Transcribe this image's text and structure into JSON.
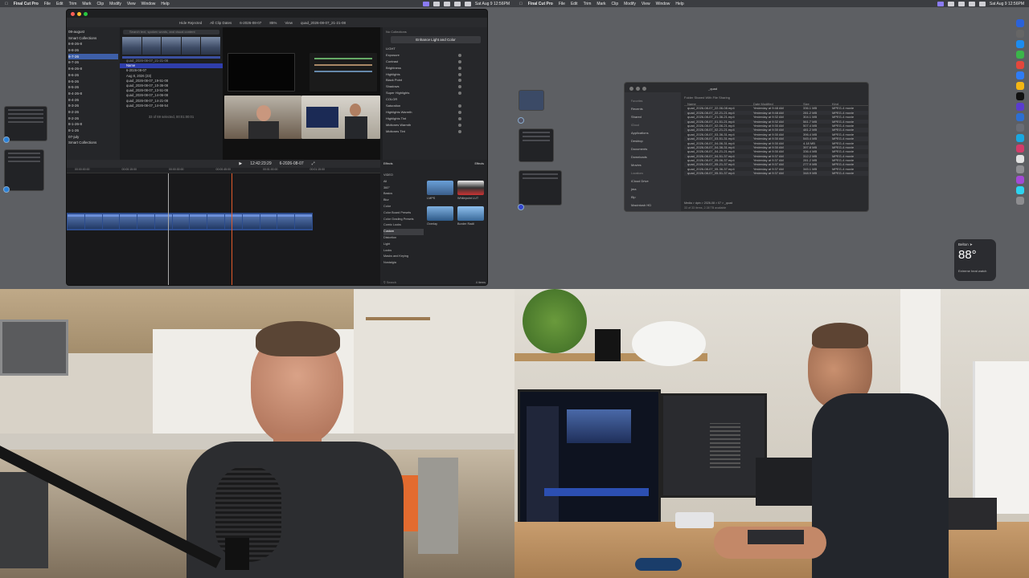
{
  "menubar": {
    "app": "Final Cut Pro",
    "items": [
      "File",
      "Edit",
      "Trim",
      "Mark",
      "Clip",
      "Modify",
      "View",
      "Window",
      "Help"
    ],
    "clock": "Sat Aug 9 12:56PM"
  },
  "fcp": {
    "toolbar": {
      "hide_rejected": "Hide Rejected",
      "clips_filter": "All Clip Dates",
      "project": "6-2026-08-07",
      "zoom": "85%",
      "view": "View",
      "inspector_clip": "quad_2026-08-07_21-21-08"
    },
    "library": {
      "items": [
        "08-august",
        "Smart Collections",
        "8-8-26-8",
        "8-8-26",
        "8-7-26",
        "8-7-26",
        "8-6-26-8",
        "8-6-26",
        "8-5-26",
        "8-5-26",
        "8-4-26-8",
        "8-4-26",
        "8-3-26",
        "8-2-26",
        "8-2-26",
        "8-1-26-8",
        "8-1-26",
        "07-july",
        "Smart Collections"
      ],
      "selected_index": 4
    },
    "browser": {
      "search_placeholder": "Search text, spoken words, and visual content",
      "filmstrip_label": "quad_2026-08-07_21-21-08",
      "name_header": "Name",
      "project_row": "6-2026-08-07",
      "date_row": "Aug 8, 2026",
      "date_count": "(33)",
      "clips": [
        "quad_2026-08-07_19-51-08",
        "quad_2026-08-07_10-36-08",
        "quad_2026-08-07_13-51-08",
        "quad_2026-08-07_14-06-08",
        "quad_2026-08-07_14-21-08",
        "quad_2026-08-07_14-66-54"
      ],
      "selection_status": "33 of 69 selected, 00:01:00:01"
    },
    "inspector": {
      "collections": "No Collections",
      "enhance_button": "Enhance Light and Color",
      "params": [
        "LIGHT",
        "Exposure",
        "Contrast",
        "Brightness",
        "Highlights",
        "Black Point",
        "Shadows",
        "Super Highlights",
        "COLOR",
        "Saturation",
        "Highlights Warmth",
        "Highlights Tint",
        "Midtones Warmth",
        "Midtones Tint"
      ]
    },
    "timeline": {
      "timecode": "12:42:23:29",
      "project_label": "6-2026-08-07",
      "ruler": [
        "00:00:00:00",
        "00:00:15:00",
        "00:00:30:00",
        "00:00:45:00",
        "00:01:00:00",
        "00:01:15:00"
      ]
    },
    "effects": {
      "title": "Effects",
      "header_right": "Effects",
      "categories": [
        "VIDEO",
        "All",
        "360°",
        "Basics",
        "Blur",
        "Color",
        "Color Board Presets",
        "Color Grading Presets",
        "Comic Looks",
        "Custom",
        "Distortion",
        "Light",
        "Looks",
        "Masks and Keying",
        "Nostalgia"
      ],
      "selected_index": 9,
      "thumbs": [
        "LMPS",
        "Whitepoint LUT",
        "Overlay",
        "Border Radii"
      ],
      "search_placeholder": "Search",
      "count": "4 items"
    }
  },
  "finder": {
    "title": "_quad",
    "sidebar": [
      "Favorites",
      "Recents",
      "Shared",
      "iCloud",
      "Applications",
      "Desktop",
      "Documents",
      "Downloads",
      "Movies",
      "Locations",
      "iCloud Drive",
      "jma",
      "f5p",
      "Macintosh HD",
      "Network"
    ],
    "info_bar": "Folder Shared With File Sharing",
    "columns": [
      "Name",
      "Date Modified",
      "Size",
      "Kind"
    ],
    "rows": [
      [
        "quad_2026-08-07_22-06-08.mp4",
        "Yesterday at 9:48 AM",
        "336.1 MB",
        "MPEG-4 movie"
      ],
      [
        "quad_2026-08-07_22-21-21.mp4",
        "Yesterday at 9:48 AM",
        "281.2 MB",
        "MPEG-4 movie"
      ],
      [
        "quad_2026-08-07_21-36-21.mp4",
        "Yesterday at 9:32 AM",
        "304.1 MB",
        "MPEG-4 movie"
      ],
      [
        "quad_2026-08-07_01-51-21.mp4",
        "Yesterday at 9:32 AM",
        "561.7 MB",
        "MPEG-4 movie"
      ],
      [
        "quad_2026-08-07_02-06-21.mp4",
        "Yesterday at 9:30 AM",
        "507.4 MB",
        "MPEG-4 movie"
      ],
      [
        "quad_2026-08-07_02-21-21.mp4",
        "Yesterday at 9:30 AM",
        "481.2 MB",
        "MPEG-4 movie"
      ],
      [
        "quad_2026-08-07_03-36-31.mp4",
        "Yesterday at 9:30 AM",
        "396.4 MB",
        "MPEG-4 movie"
      ],
      [
        "quad_2026-08-07_03-51-31.mp4",
        "Yesterday at 9:30 AM",
        "545.4 MB",
        "MPEG-4 movie"
      ],
      [
        "quad_2026-08-07_04-06-31.mp4",
        "Yesterday at 9:30 AM",
        "4.18 MB",
        "MPEG-4 movie"
      ],
      [
        "quad_2026-08-07_04-36-31.mp4",
        "Yesterday at 9:30 AM",
        "397.8 MB",
        "MPEG-4 movie"
      ],
      [
        "quad_2026-08-07_04-21-21.mp4",
        "Yesterday at 9:30 AM",
        "336.4 MB",
        "MPEG-4 movie"
      ],
      [
        "quad_2026-08-07_04-51-37.mp4",
        "Yesterday at 9:37 AM",
        "312.2 MB",
        "MPEG-4 movie"
      ],
      [
        "quad_2026-08-07_05-06-37.mp4",
        "Yesterday at 9:37 AM",
        "281.2 MB",
        "MPEG-4 movie"
      ],
      [
        "quad_2026-08-07_05-21-37.mp4",
        "Yesterday at 9:37 AM",
        "277.9 MB",
        "MPEG-4 movie"
      ],
      [
        "quad_2026-08-07_05-36-37.mp4",
        "Yesterday at 9:37 AM",
        "345.1 MB",
        "MPEG-4 movie"
      ],
      [
        "quad_2026-08-07_05-51-37.mp4",
        "Yesterday at 9:37 AM",
        "348.9 MB",
        "MPEG-4 movie"
      ]
    ],
    "path_bar": "Media > dpin > 2026-08 > 07 > _quad",
    "status": "33 of 33 items, 2.38 TB available"
  },
  "weather": {
    "location": "Belton",
    "temperature": "88°",
    "condition": "Extreme heat watch"
  },
  "colors": {
    "accent": "#8b7cf6",
    "selection": "#3e5fa8",
    "playhead": "#e05a2a"
  }
}
